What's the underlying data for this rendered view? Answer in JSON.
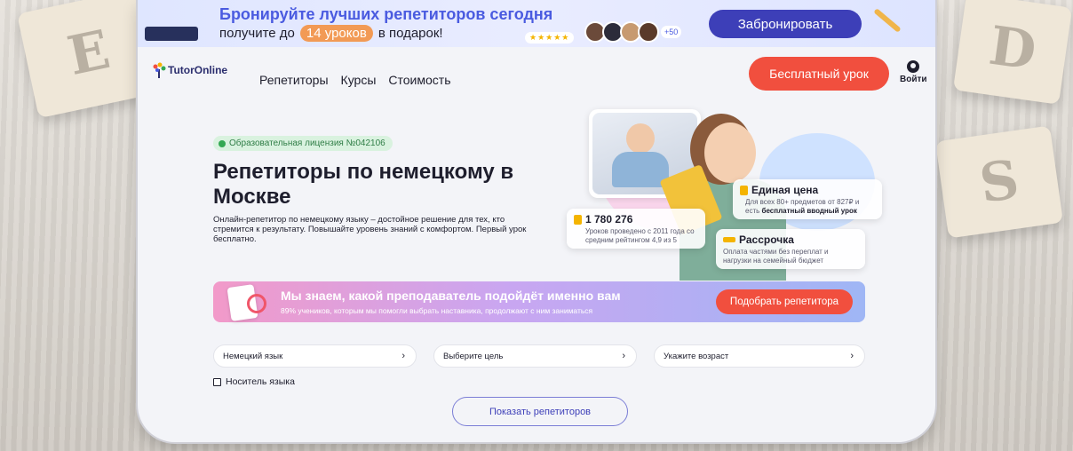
{
  "promo": {
    "title": "Бронируйте лучших репетиторов сегодня",
    "sub_before": "получите до",
    "sub_badge": "14 уроков",
    "sub_after": "в подарок!",
    "stars": "★★★★★",
    "avatars_more": "+50",
    "button": "Забронировать"
  },
  "header": {
    "logo": "TutorOnline",
    "nav": [
      "Репетиторы",
      "Курсы",
      "Стоимость"
    ],
    "free_lesson": "Бесплатный урок",
    "login": "Войти"
  },
  "hero": {
    "license": "Образовательная лицензия №042106",
    "title": "Репетиторы по немецкому в Москве",
    "lead": "Онлайн-репетитор по немецкому языку – достойное решение для тех, кто стремится к результату. Повышайте уровень знаний с комфортом. Первый урок бесплатно."
  },
  "stats": {
    "lessons": {
      "title": "1 780 276",
      "text": "Уроков проведено с 2011 года со средним рейтингом 4,9 из 5"
    },
    "price": {
      "title": "Единая цена",
      "text_before": "Для всех 80+ предметов от 827₽ и есть",
      "text_bold": "бесплатный вводный урок"
    },
    "installment": {
      "title": "Рассрочка",
      "text": "Оплата частями без переплат и нагрузки на семейный бюджет"
    }
  },
  "pick": {
    "title": "Мы знаем, какой преподаватель подойдёт именно вам",
    "sub": "89% учеников, которым мы помогли выбрать наставника, продолжают с ним заниматься",
    "button": "Подобрать репетитора"
  },
  "filters": {
    "language": "Немецкий язык",
    "goal": "Выберите цель",
    "age": "Укажите возраст",
    "chevron": "›",
    "native": "Носитель языка",
    "show": "Показать репетиторов"
  },
  "colors": {
    "accent_red": "#f14f3e",
    "brand_indigo": "#3d3fb8",
    "license_green": "#34a853"
  }
}
